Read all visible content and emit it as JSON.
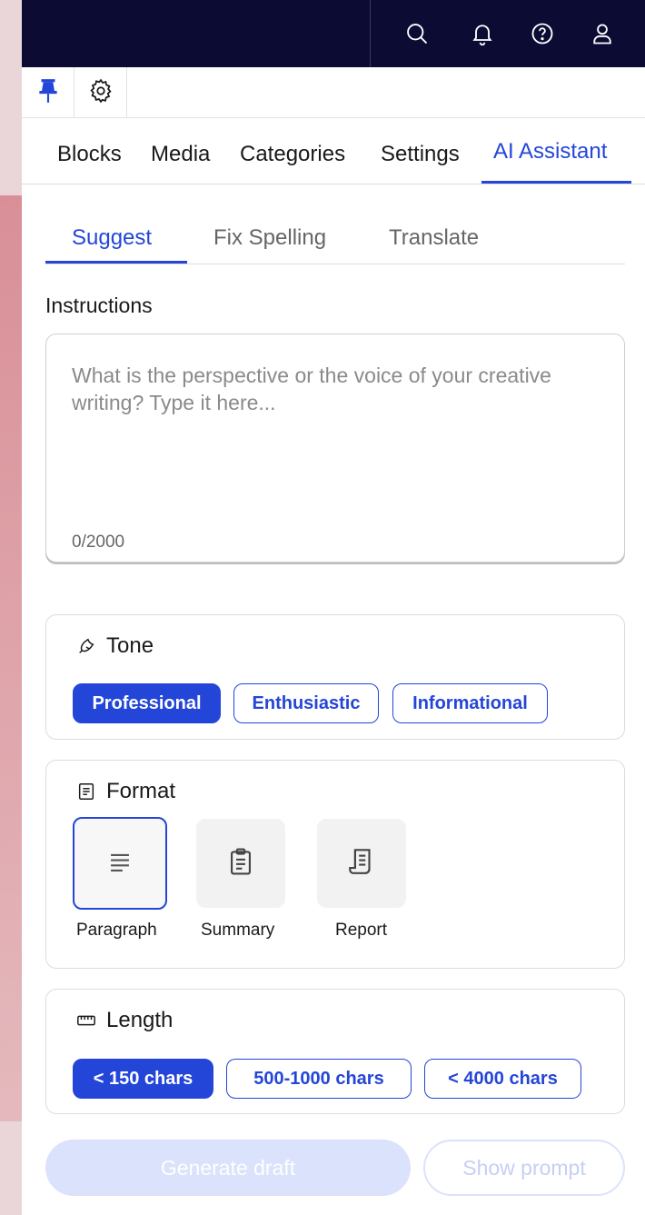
{
  "header": {
    "icons": [
      "search-icon",
      "bell-icon",
      "help-icon",
      "user-icon"
    ]
  },
  "toolbar": {
    "icons": [
      "pin-icon",
      "gear-icon"
    ],
    "pin_color": "#2446d8"
  },
  "main_tabs": [
    {
      "label": "Blocks",
      "active": false
    },
    {
      "label": "Media",
      "active": false
    },
    {
      "label": "Categories",
      "active": false
    },
    {
      "label": "Settings",
      "active": false
    },
    {
      "label": "AI Assistant",
      "active": true
    }
  ],
  "sub_tabs": [
    {
      "label": "Suggest",
      "active": true
    },
    {
      "label": "Fix Spelling",
      "active": false
    },
    {
      "label": "Translate",
      "active": false
    }
  ],
  "instructions": {
    "label": "Instructions",
    "value": "",
    "placeholder": "What is the perspective or the voice of your creative writing? Type it here...",
    "counter": "0/2000"
  },
  "tone": {
    "title": "Tone",
    "icon": "megaphone-icon",
    "options": [
      "Professional",
      "Enthusiastic",
      "Informational"
    ],
    "selected": "Professional"
  },
  "format": {
    "title": "Format",
    "icon": "document-icon",
    "options": [
      {
        "label": "Paragraph",
        "icon": "paragraph-icon"
      },
      {
        "label": "Summary",
        "icon": "clipboard-icon"
      },
      {
        "label": "Report",
        "icon": "scroll-icon"
      }
    ],
    "selected": "Paragraph"
  },
  "length": {
    "title": "Length",
    "icon": "ruler-icon",
    "options": [
      "< 150 chars",
      "500-1000 chars",
      "< 4000 chars"
    ],
    "selected": "< 150 chars"
  },
  "actions": {
    "generate_label": "Generate draft",
    "show_prompt_label": "Show prompt"
  },
  "colors": {
    "accent": "#2446d8",
    "header_bg": "#0b0b33",
    "disabled_primary": "#dbe2fb"
  }
}
